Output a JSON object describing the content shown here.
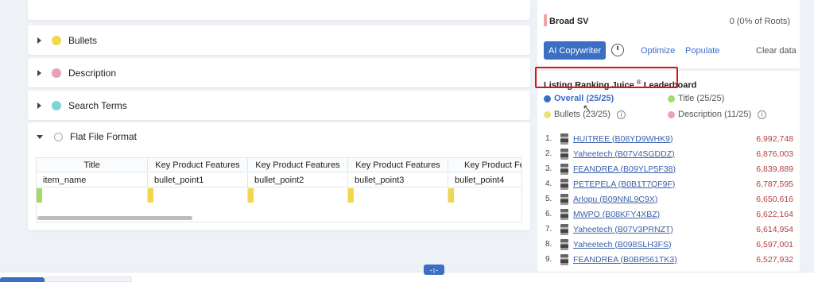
{
  "sections": {
    "bullets": {
      "label": "Bullets",
      "color": "#f0d84a"
    },
    "description": {
      "label": "Description",
      "color": "#e8a2b4"
    },
    "search_terms": {
      "label": "Search Terms",
      "color": "#7fd4d8"
    },
    "flat_file": {
      "label": "Flat File Format"
    }
  },
  "flat_table": {
    "headers": [
      "Title",
      "Key Product Features",
      "Key Product Features",
      "Key Product Features",
      "Key Product Feat"
    ],
    "row": [
      "item_name",
      "bullet_point1",
      "bullet_point2",
      "bullet_point3",
      "bullet_point4"
    ],
    "marker_colors": [
      "#a6d96a",
      "#f0d84a",
      "#f0d84a",
      "#f0d84a",
      "#f0d84a"
    ]
  },
  "right": {
    "broad_sv": {
      "label": "Broad SV",
      "value": "0 (0% of Roots)"
    },
    "ai_button": "AI Copywriter",
    "optimize": "Optimize",
    "populate": "Populate",
    "clear": "Clear data"
  },
  "leaderboard": {
    "title": "Listing Ranking Juice",
    "title_mark": "®",
    "title_suffix": "Leaderboard",
    "legend": {
      "overall": {
        "label": "Overall (25/25)",
        "color": "#3a6fc4"
      },
      "title": {
        "label": "Title (25/25)",
        "color": "#a6d96a"
      },
      "bullets": {
        "label": "Bullets (23/25)",
        "color": "#f0e07a"
      },
      "description": {
        "label": "Description (11/25)",
        "color": "#e8a2b4"
      }
    },
    "rows": [
      {
        "num": "1.",
        "name": "HUITREE (B08YD9WHK9)",
        "value": "6,992,748"
      },
      {
        "num": "2.",
        "name": "Yaheetech (B07V4SGDDZ)",
        "value": "6,876,003"
      },
      {
        "num": "3.",
        "name": "FEANDREA (B09YLP5F38)",
        "value": "6,839,889"
      },
      {
        "num": "4.",
        "name": "PETEPELA (B0B1T7QF9F)",
        "value": "6,787,595"
      },
      {
        "num": "5.",
        "name": "Arlopu (B09NNL9C9X)",
        "value": "6,650,616"
      },
      {
        "num": "6.",
        "name": "MWPO (B08KFY4XBZ)",
        "value": "6,622,164"
      },
      {
        "num": "7.",
        "name": "Yaheetech (B07V3PRNZT)",
        "value": "6,614,954"
      },
      {
        "num": "8.",
        "name": "Yaheetech (B098SLH3FS)",
        "value": "6,597,001"
      },
      {
        "num": "9.",
        "name": "FEANDREA (B0BR561TK3)",
        "value": "6,527,932"
      }
    ]
  },
  "resize_handle": "-↕-"
}
